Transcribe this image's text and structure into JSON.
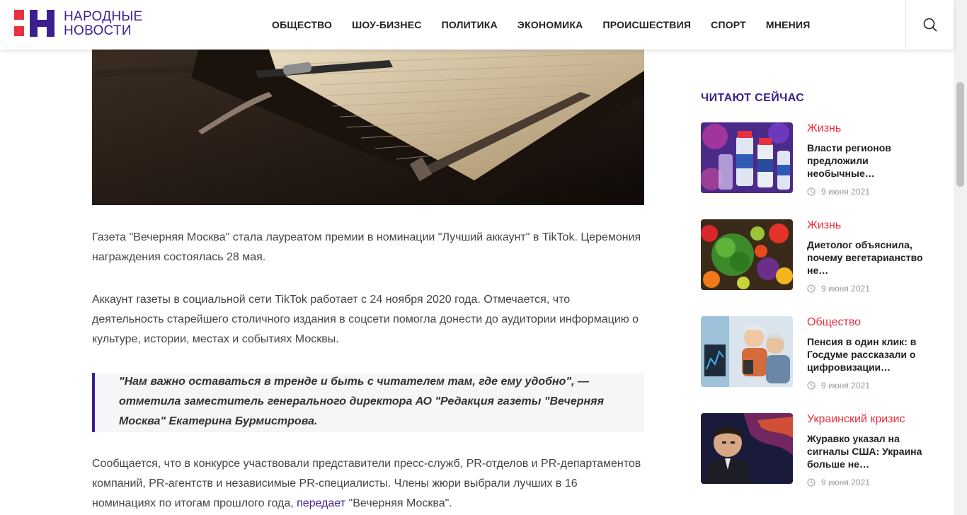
{
  "header": {
    "logo_line1": "НАРОДНЫЕ",
    "logo_line2": "НОВОСТИ",
    "nav": [
      "ОБЩЕСТВО",
      "ШОУ-БИЗНЕС",
      "ПОЛИТИКА",
      "ЭКОНОМИКА",
      "ПРОИСШЕСТВИЯ",
      "СПОРТ",
      "МНЕНИЯ"
    ],
    "search_icon": "search-icon"
  },
  "article": {
    "p1": "Газета \"Вечерняя Москва\" стала лауреатом премии в номинации \"Лучший аккаунт\" в TikTok. Церемония награждения состоялась 28 мая.",
    "p2": "Аккаунт газеты в социальной сети TikTok работает с 24 ноября 2020 года. Отмечается, что деятельность старейшего столичного издания в соцсети помогла донести до аудитории информацию о культуре, истории, местах и событиях Москвы.",
    "quote": "\"Нам важно оставаться в тренде и быть с читателем там, где ему удобно\", — отметила заместитель генерального директора АО \"Редакция газеты \"Вечерняя Москва\" Екатерина Бурмистрова.",
    "p3_before": "Сообщается, что в конкурсе участвовали представители пресс-служб, PR-отделов и PR-департаментов компаний, PR-агентств и независимые PR-специалисты. Члены жюри выбрали лучших в 16 номинациях по итогам прошлого года, ",
    "p3_link": "передает",
    "p3_after": " \"Вечерняя Москва\"."
  },
  "sidebar": {
    "title": "ЧИТАЮТ СЕЙЧАС",
    "items": [
      {
        "category": "Жизнь",
        "headline": "Власти регионов предложили необычные…",
        "date": "9 июня 2021"
      },
      {
        "category": "Жизнь",
        "headline": "Диетолог объяснила, почему вегетарианство не…",
        "date": "9 июня 2021"
      },
      {
        "category": "Общество",
        "headline": "Пенсия в один клик: в Госдуме рассказали о цифровизации…",
        "date": "9 июня 2021"
      },
      {
        "category": "Украинский кризис",
        "headline": "Журавко указал на сигналы США: Украина больше не…",
        "date": "9 июня 2021"
      }
    ]
  },
  "colors": {
    "brand": "#3c1f8f",
    "accent": "#e8303f"
  }
}
